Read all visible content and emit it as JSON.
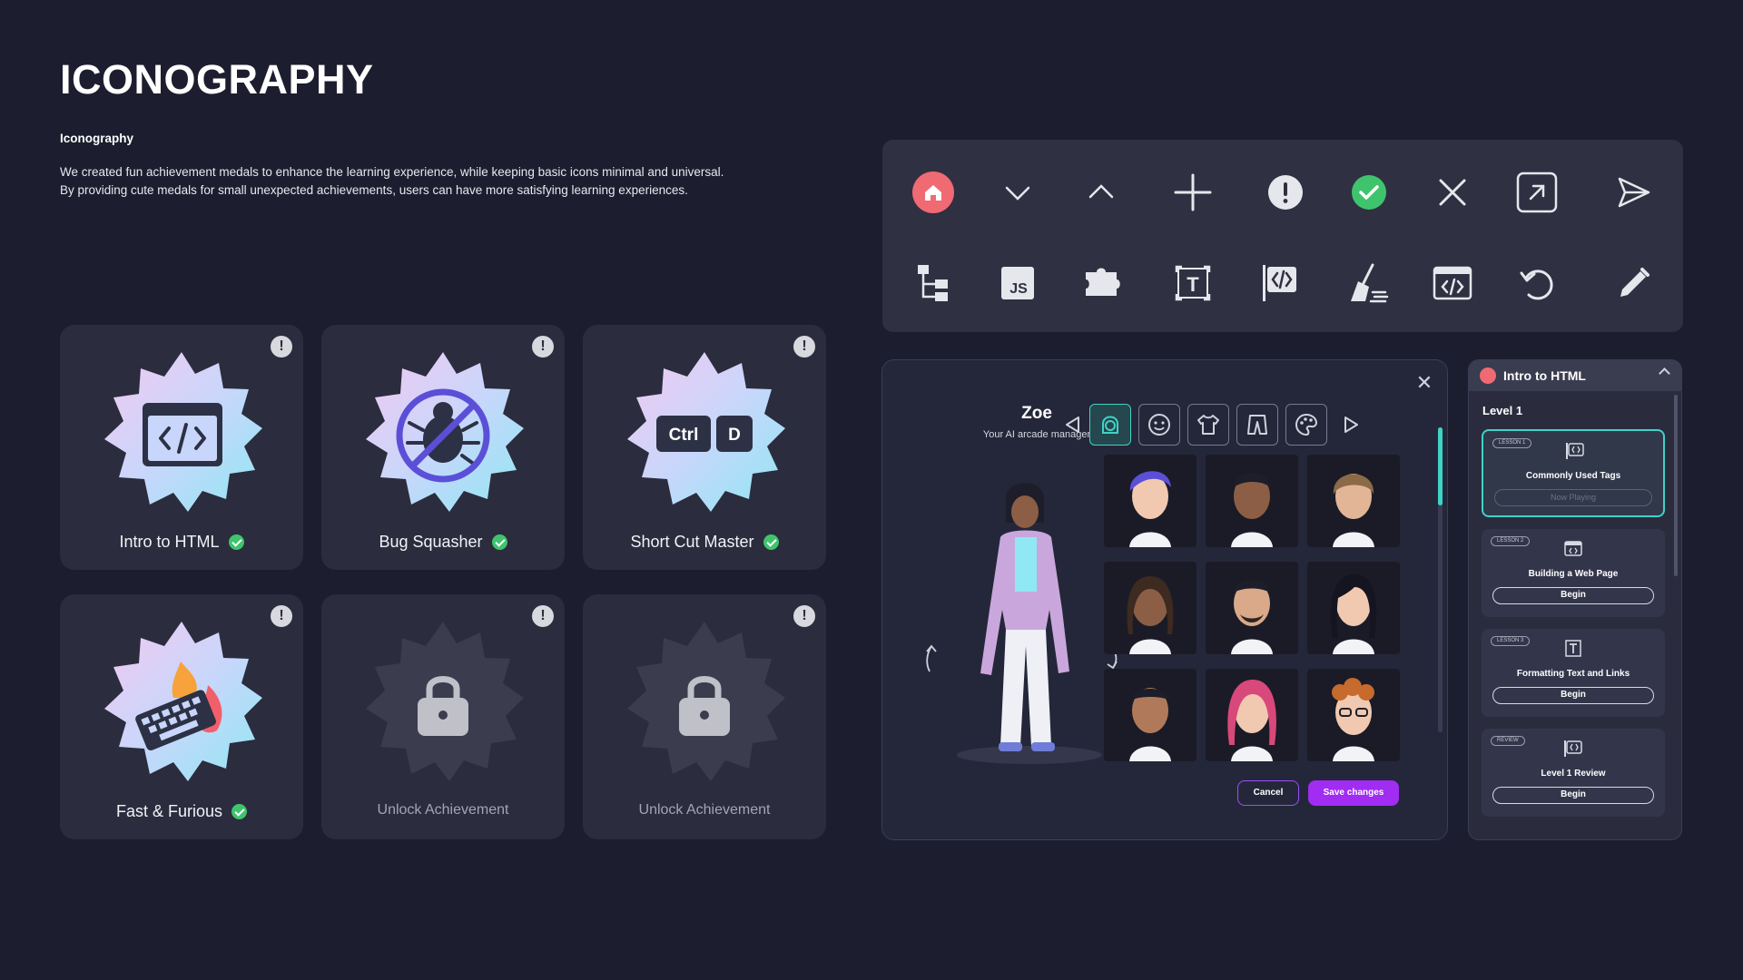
{
  "page": {
    "title": "ICONOGRAPHY",
    "subheading": "Iconography",
    "description_lines": [
      "We created fun achievement medals to enhance the learning experience, while keeping basic icons minimal and universal.",
      "By providing cute medals for small unexpected achievements, users can have more satisfying learning experiences."
    ]
  },
  "achievements": [
    {
      "name": "Intro to HTML",
      "icon": "code-window-icon",
      "status": "earned"
    },
    {
      "name": "Bug Squasher",
      "icon": "no-bug-icon",
      "status": "earned"
    },
    {
      "name": "Short Cut Master",
      "icon": "keyboard-shortcut-icon",
      "status": "earned",
      "keys": [
        "Ctrl",
        "D"
      ]
    },
    {
      "name": "Fast & Furious",
      "icon": "keyboard-fire-icon",
      "status": "earned"
    },
    {
      "name": "Unlock Achievement",
      "icon": "lock-icon",
      "status": "locked"
    },
    {
      "name": "Unlock Achievement",
      "icon": "lock-icon",
      "status": "locked"
    }
  ],
  "icon_set": {
    "row1": [
      "home-icon",
      "chevron-down-icon",
      "chevron-up-icon",
      "plus-icon",
      "alert-icon",
      "success-check-icon",
      "close-icon",
      "open-external-icon",
      "send-icon"
    ],
    "row2": [
      "file-tree-icon",
      "js-file-icon",
      "puzzle-icon",
      "text-box-icon",
      "code-flag-icon",
      "broom-icon",
      "code-window-icon",
      "undo-icon",
      "pencil-icon"
    ],
    "js_label": "JS",
    "text_label": "T",
    "colors": {
      "home": "#ef6a72",
      "success": "#3fc46d",
      "alert": "#e6e7ec"
    }
  },
  "avatar_editor": {
    "name": "Zoe",
    "subtitle": "Your AI arcade manager",
    "tabs": [
      "head-icon",
      "face-icon",
      "shirt-icon",
      "pants-icon",
      "palette-icon"
    ],
    "active_tab": 0,
    "avatars": 9,
    "cancel_label": "Cancel",
    "save_label": "Save changes",
    "accent": "#a12cf2",
    "tab_accent": "#3fd3c6"
  },
  "lesson_panel": {
    "title": "Intro to HTML",
    "level": "Level 1",
    "lessons": [
      {
        "tag": "LESSON 1",
        "title": "Commonly Used Tags",
        "action": "Now Playing",
        "icon": "code-flag-icon",
        "active": true
      },
      {
        "tag": "LESSON 2",
        "title": "Building a Web Page",
        "action": "Begin",
        "icon": "code-window-icon",
        "active": false
      },
      {
        "tag": "LESSON 3",
        "title": "Formatting Text and Links",
        "action": "Begin",
        "icon": "text-box-icon",
        "active": false
      },
      {
        "tag": "REVIEW",
        "title": "Level 1 Review",
        "action": "Begin",
        "icon": "code-flag-icon",
        "active": false
      }
    ]
  }
}
